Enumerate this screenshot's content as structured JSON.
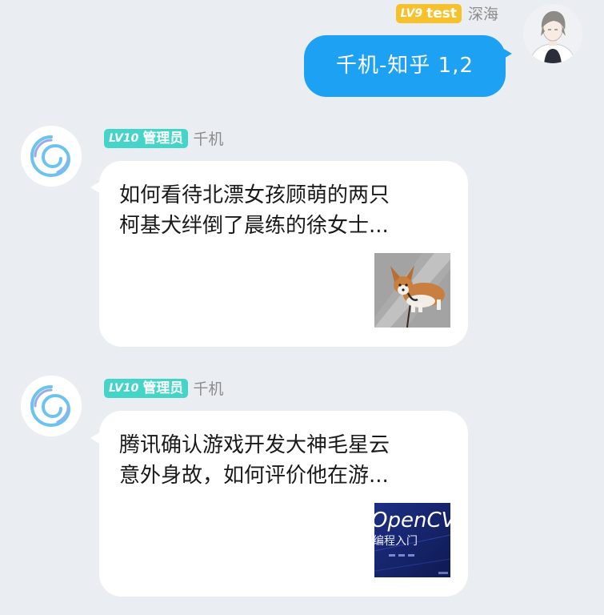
{
  "outgoing": {
    "badge": {
      "level": "LV9",
      "title": "test"
    },
    "nickname": "深海",
    "avatar": "avatar-user-icon",
    "message": "千机-知乎 1,2"
  },
  "incoming": [
    {
      "badge": {
        "level": "LV10",
        "title": "管理员"
      },
      "nickname": "千机",
      "avatar": "spiral-logo-icon",
      "title_lines": [
        "如何看待北漂女孩顾萌的两只",
        "柯基犬绊倒了晨练的徐女士..."
      ],
      "thumbnail": "corgi-dog-photo"
    },
    {
      "badge": {
        "level": "LV10",
        "title": "管理员"
      },
      "nickname": "千机",
      "avatar": "spiral-logo-icon",
      "title_lines": [
        "腾讯确认游戏开发大神毛星云",
        "意外身故，如何评价他在游..."
      ],
      "thumbnail": {
        "name": "opencv-cover",
        "text_main": "OpenCV",
        "text_sub": "编程入门"
      }
    }
  ],
  "colors": {
    "background": "#eaeef2",
    "outgoing_bubble": "#1da1f2",
    "badge_gold": "#f6c12a",
    "badge_teal": "#44d4c8"
  }
}
